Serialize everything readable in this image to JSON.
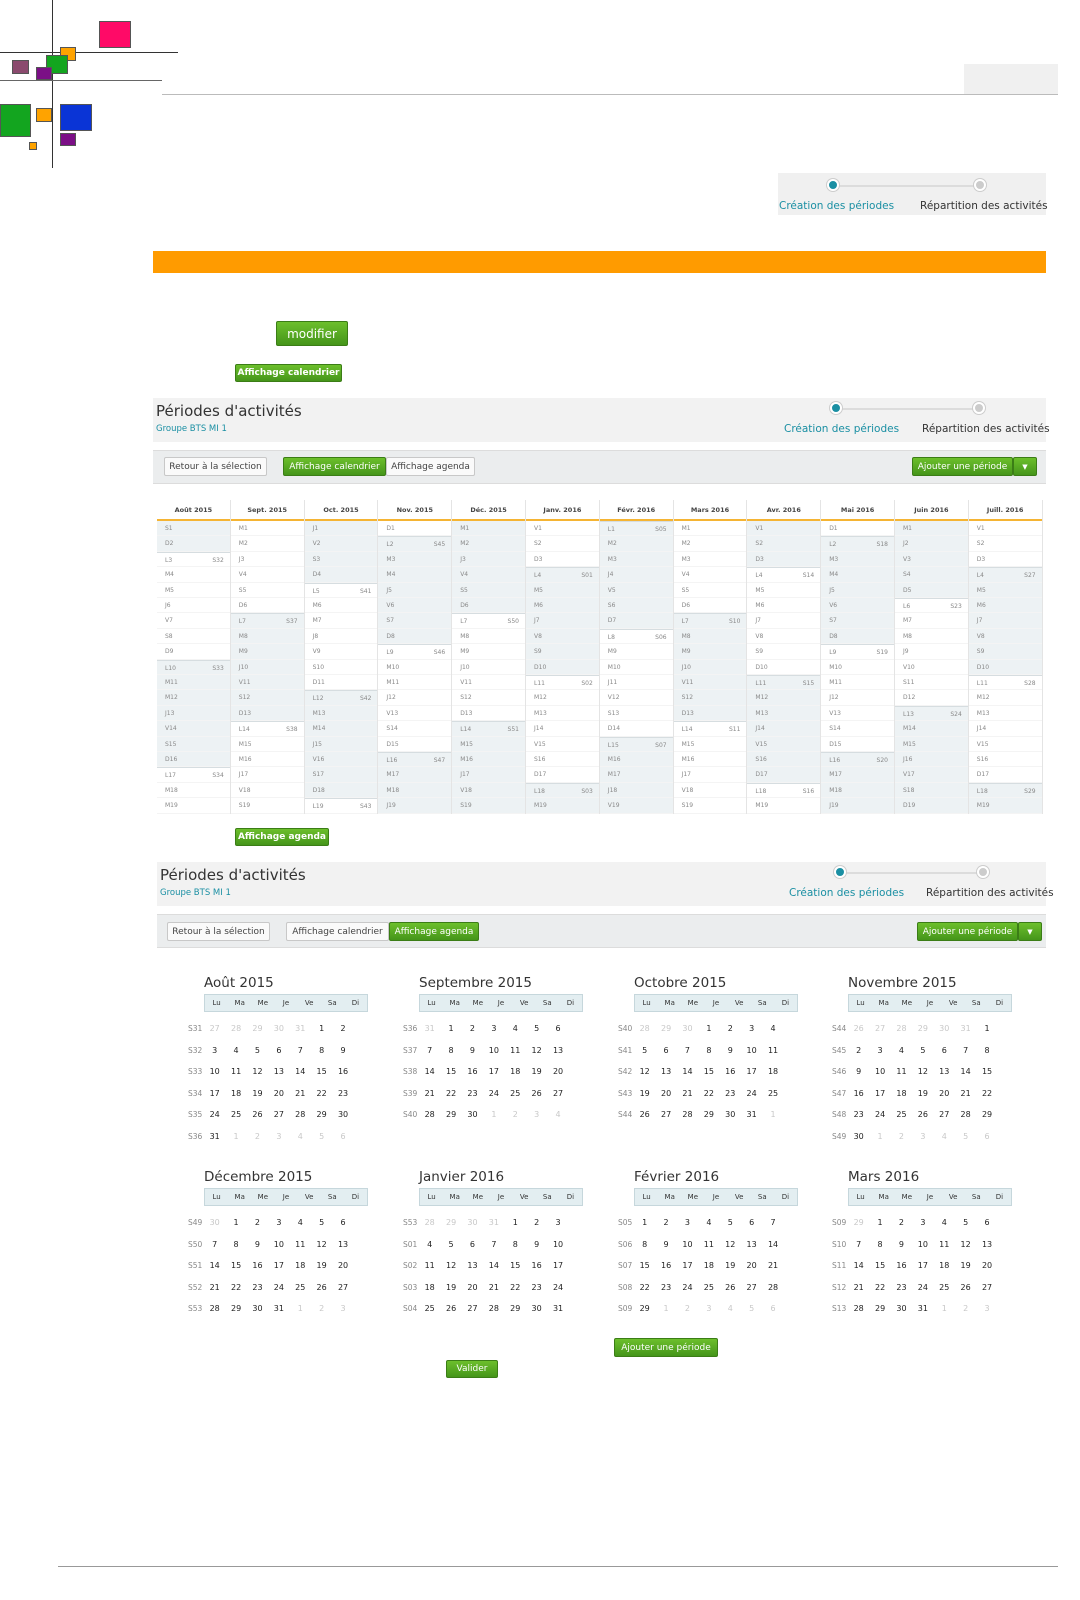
{
  "header": {
    "colors": {
      "pink": "#ff0a67",
      "orange": "#ffa300",
      "green": "#13a51f",
      "purple": "#7b0f86",
      "mauve": "#8b4a6e",
      "blue": "#0a34d6"
    }
  },
  "stepper": {
    "step1": "Création des périodes",
    "step2": "Répartition des activités"
  },
  "accent_bar_color": "#ff9b00",
  "buttons": {
    "modifier": "modifier",
    "affichage_calendrier": "Affichage calendrier",
    "affichage_agenda": "Affichage agenda",
    "valider": "Valider",
    "ajouter_periode": "Ajouter une période",
    "retour": "Retour à la sélection",
    "dropdown": "▼"
  },
  "panel": {
    "title": "Périodes d'activités",
    "subtitle": "Groupe BTS MI 1"
  },
  "calendar_view": {
    "months": [
      {
        "label": "Août 2015",
        "days": [
          "S1",
          "D2",
          "L3|S32",
          "M4",
          "M5",
          "J6",
          "V7",
          "S8",
          "D9",
          "L10|S33",
          "M11",
          "M12",
          "J13",
          "V14",
          "S15",
          "D16",
          "L17|S34",
          "M18",
          "M19"
        ]
      },
      {
        "label": "Sept. 2015",
        "days": [
          "M1",
          "M2",
          "J3",
          "V4",
          "S5",
          "D6",
          "L7|S37",
          "M8",
          "M9",
          "J10",
          "V11",
          "S12",
          "D13",
          "L14|S38",
          "M15",
          "M16",
          "J17",
          "V18",
          "S19"
        ]
      },
      {
        "label": "Oct. 2015",
        "days": [
          "J1",
          "V2",
          "S3",
          "D4",
          "L5|S41",
          "M6",
          "M7",
          "J8",
          "V9",
          "S10",
          "D11",
          "L12|S42",
          "M13",
          "M14",
          "J15",
          "V16",
          "S17",
          "D18",
          "L19|S43"
        ]
      },
      {
        "label": "Nov. 2015",
        "days": [
          "D1",
          "L2|S45",
          "M3",
          "M4",
          "J5",
          "V6",
          "S7",
          "D8",
          "L9|S46",
          "M10",
          "M11",
          "J12",
          "V13",
          "S14",
          "D15",
          "L16|S47",
          "M17",
          "M18",
          "J19"
        ]
      },
      {
        "label": "Déc. 2015",
        "days": [
          "M1",
          "M2",
          "J3",
          "V4",
          "S5",
          "D6",
          "L7|S50",
          "M8",
          "M9",
          "J10",
          "V11",
          "S12",
          "D13",
          "L14|S51",
          "M15",
          "M16",
          "J17",
          "V18",
          "S19"
        ]
      },
      {
        "label": "Janv. 2016",
        "days": [
          "V1",
          "S2",
          "D3",
          "L4|S01",
          "M5",
          "M6",
          "J7",
          "V8",
          "S9",
          "D10",
          "L11|S02",
          "M12",
          "M13",
          "J14",
          "V15",
          "S16",
          "D17",
          "L18|S03",
          "M19"
        ]
      },
      {
        "label": "Févr. 2016",
        "days": [
          "L1|S05",
          "M2",
          "M3",
          "J4",
          "V5",
          "S6",
          "D7",
          "L8|S06",
          "M9",
          "M10",
          "J11",
          "V12",
          "S13",
          "D14",
          "L15|S07",
          "M16",
          "M17",
          "J18",
          "V19"
        ]
      },
      {
        "label": "Mars 2016",
        "days": [
          "M1",
          "M2",
          "M3",
          "V4",
          "S5",
          "D6",
          "L7|S10",
          "M8",
          "M9",
          "J10",
          "V11",
          "S12",
          "D13",
          "L14|S11",
          "M15",
          "M16",
          "J17",
          "V18",
          "S19"
        ]
      },
      {
        "label": "Avr. 2016",
        "days": [
          "V1",
          "S2",
          "D3",
          "L4|S14",
          "M5",
          "M6",
          "J7",
          "V8",
          "S9",
          "D10",
          "L11|S15",
          "M12",
          "M13",
          "J14",
          "V15",
          "S16",
          "D17",
          "L18|S16",
          "M19"
        ]
      },
      {
        "label": "Mai 2016",
        "days": [
          "D1",
          "L2|S18",
          "M3",
          "M4",
          "J5",
          "V6",
          "S7",
          "D8",
          "L9|S19",
          "M10",
          "M11",
          "J12",
          "V13",
          "S14",
          "D15",
          "L16|S20",
          "M17",
          "M18",
          "J19"
        ]
      },
      {
        "label": "Juin 2016",
        "days": [
          "M1",
          "J2",
          "V3",
          "S4",
          "D5",
          "L6|S23",
          "M7",
          "M8",
          "J9",
          "V10",
          "S11",
          "D12",
          "L13|S24",
          "M14",
          "M15",
          "J16",
          "V17",
          "S18",
          "D19"
        ]
      },
      {
        "label": "Juill. 2016",
        "days": [
          "V1",
          "S2",
          "D3",
          "L4|S27",
          "M5",
          "M6",
          "J7",
          "V8",
          "S9",
          "D10",
          "L11|S28",
          "M12",
          "M13",
          "J14",
          "V15",
          "S16",
          "D17",
          "L18|S29",
          "M19"
        ]
      }
    ]
  },
  "agenda_view": {
    "weekday_headers": [
      "Lu",
      "Ma",
      "Me",
      "Je",
      "Ve",
      "Sa",
      "Di"
    ],
    "months": [
      {
        "label": "Août 2015",
        "rows": [
          [
            "S31",
            "27*",
            "28*",
            "29*",
            "30*",
            "31*",
            "1",
            "2"
          ],
          [
            "S32",
            "3",
            "4",
            "5",
            "6",
            "7",
            "8",
            "9"
          ],
          [
            "S33",
            "10",
            "11",
            "12",
            "13",
            "14",
            "15",
            "16"
          ],
          [
            "S34",
            "17",
            "18",
            "19",
            "20",
            "21",
            "22",
            "23"
          ],
          [
            "S35",
            "24",
            "25",
            "26",
            "27",
            "28",
            "29",
            "30"
          ],
          [
            "S36",
            "31",
            "1*",
            "2*",
            "3*",
            "4*",
            "5*",
            "6*"
          ]
        ]
      },
      {
        "label": "Septembre 2015",
        "rows": [
          [
            "S36",
            "31*",
            "1",
            "2",
            "3",
            "4",
            "5",
            "6"
          ],
          [
            "S37",
            "7",
            "8",
            "9",
            "10",
            "11",
            "12",
            "13"
          ],
          [
            "S38",
            "14",
            "15",
            "16",
            "17",
            "18",
            "19",
            "20"
          ],
          [
            "S39",
            "21",
            "22",
            "23",
            "24",
            "25",
            "26",
            "27"
          ],
          [
            "S40",
            "28",
            "29",
            "30",
            "1*",
            "2*",
            "3*",
            "4*"
          ]
        ]
      },
      {
        "label": "Octobre 2015",
        "rows": [
          [
            "S40",
            "28*",
            "29*",
            "30*",
            "1",
            "2",
            "3",
            "4"
          ],
          [
            "S41",
            "5",
            "6",
            "7",
            "8",
            "9",
            "10",
            "11"
          ],
          [
            "S42",
            "12",
            "13",
            "14",
            "15",
            "16",
            "17",
            "18"
          ],
          [
            "S43",
            "19",
            "20",
            "21",
            "22",
            "23",
            "24",
            "25"
          ],
          [
            "S44",
            "26",
            "27",
            "28",
            "29",
            "30",
            "31",
            "1*"
          ]
        ]
      },
      {
        "label": "Novembre 2015",
        "rows": [
          [
            "S44",
            "26*",
            "27*",
            "28*",
            "29*",
            "30*",
            "31*",
            "1"
          ],
          [
            "S45",
            "2",
            "3",
            "4",
            "5",
            "6",
            "7",
            "8"
          ],
          [
            "S46",
            "9",
            "10",
            "11",
            "12",
            "13",
            "14",
            "15"
          ],
          [
            "S47",
            "16",
            "17",
            "18",
            "19",
            "20",
            "21",
            "22"
          ],
          [
            "S48",
            "23",
            "24",
            "25",
            "26",
            "27",
            "28",
            "29"
          ],
          [
            "S49",
            "30",
            "1*",
            "2*",
            "3*",
            "4*",
            "5*",
            "6*"
          ]
        ]
      },
      {
        "label": "Décembre 2015",
        "rows": [
          [
            "S49",
            "30*",
            "1",
            "2",
            "3",
            "4",
            "5",
            "6"
          ],
          [
            "S50",
            "7",
            "8",
            "9",
            "10",
            "11",
            "12",
            "13"
          ],
          [
            "S51",
            "14",
            "15",
            "16",
            "17",
            "18",
            "19",
            "20"
          ],
          [
            "S52",
            "21",
            "22",
            "23",
            "24",
            "25",
            "26",
            "27"
          ],
          [
            "S53",
            "28",
            "29",
            "30",
            "31",
            "1*",
            "2*",
            "3*"
          ]
        ]
      },
      {
        "label": "Janvier 2016",
        "rows": [
          [
            "S53",
            "28*",
            "29*",
            "30*",
            "31*",
            "1",
            "2",
            "3"
          ],
          [
            "S01",
            "4",
            "5",
            "6",
            "7",
            "8",
            "9",
            "10"
          ],
          [
            "S02",
            "11",
            "12",
            "13",
            "14",
            "15",
            "16",
            "17"
          ],
          [
            "S03",
            "18",
            "19",
            "20",
            "21",
            "22",
            "23",
            "24"
          ],
          [
            "S04",
            "25",
            "26",
            "27",
            "28",
            "29",
            "30",
            "31"
          ]
        ]
      },
      {
        "label": "Février 2016",
        "rows": [
          [
            "S05",
            "1",
            "2",
            "3",
            "4",
            "5",
            "6",
            "7"
          ],
          [
            "S06",
            "8",
            "9",
            "10",
            "11",
            "12",
            "13",
            "14"
          ],
          [
            "S07",
            "15",
            "16",
            "17",
            "18",
            "19",
            "20",
            "21"
          ],
          [
            "S08",
            "22",
            "23",
            "24",
            "25",
            "26",
            "27",
            "28"
          ],
          [
            "S09",
            "29",
            "1*",
            "2*",
            "3*",
            "4*",
            "5*",
            "6*"
          ]
        ]
      },
      {
        "label": "Mars 2016",
        "rows": [
          [
            "S09",
            "29*",
            "1",
            "2",
            "3",
            "4",
            "5",
            "6"
          ],
          [
            "S10",
            "7",
            "8",
            "9",
            "10",
            "11",
            "12",
            "13"
          ],
          [
            "S11",
            "14",
            "15",
            "16",
            "17",
            "18",
            "19",
            "20"
          ],
          [
            "S12",
            "21",
            "22",
            "23",
            "24",
            "25",
            "26",
            "27"
          ],
          [
            "S13",
            "28",
            "29",
            "30",
            "31",
            "1*",
            "2*",
            "3*"
          ]
        ]
      }
    ]
  }
}
